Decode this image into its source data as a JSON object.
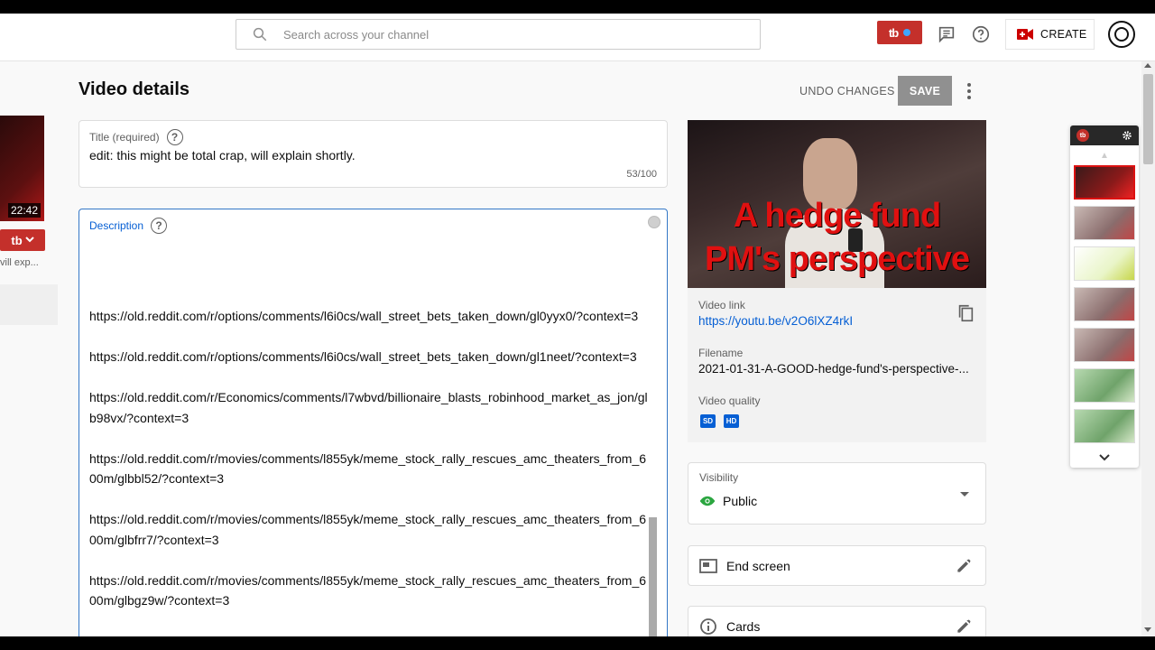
{
  "header": {
    "search_placeholder": "Search across your channel",
    "tb_label": "tb",
    "create_label": "CREATE"
  },
  "left_strip": {
    "duration": "22:42",
    "tb_label": "tb",
    "snippet": "vill exp..."
  },
  "page": {
    "title": "Video details",
    "undo_label": "UNDO CHANGES",
    "save_label": "SAVE"
  },
  "title_field": {
    "label": "Title (required)",
    "value": "edit: this might be total crap, will explain shortly.",
    "count": "53/100"
  },
  "description": {
    "label": "Description",
    "links": [
      "https://old.reddit.com/r/options/comments/l6i0cs/wall_street_bets_taken_down/gl0yyx0/?context=3",
      "https://old.reddit.com/r/options/comments/l6i0cs/wall_street_bets_taken_down/gl1neet/?context=3",
      "https://old.reddit.com/r/Economics/comments/l7wbvd/billionaire_blasts_robinhood_market_as_jon/glb98vx/?context=3",
      "https://old.reddit.com/r/movies/comments/l855yk/meme_stock_rally_rescues_amc_theaters_from_600m/glbbl52/?context=3",
      "https://old.reddit.com/r/movies/comments/l855yk/meme_stock_rally_rescues_amc_theaters_from_600m/glbfrr7/?context=3",
      "https://old.reddit.com/r/movies/comments/l855yk/meme_stock_rally_rescues_amc_theaters_from_600m/glbgz9w/?context=3"
    ]
  },
  "preview": {
    "thumb_line1": "A hedge fund",
    "thumb_line2": "PM's perspective",
    "video_link_label": "Video link",
    "video_link": "https://youtu.be/v2O6lXZ4rkI",
    "filename_label": "Filename",
    "filename": "2021-01-31-A-GOOD-hedge-fund's-perspective-...",
    "quality_label": "Video quality",
    "quality_sd": "SD",
    "quality_hd": "HD"
  },
  "visibility": {
    "label": "Visibility",
    "value": "Public"
  },
  "end_screen": {
    "label": "End screen"
  },
  "cards": {
    "label": "Cards"
  },
  "tb_panel": {
    "logo": "tb"
  },
  "colors": {
    "accent_blue": "#065fd4",
    "brand_red": "#c4302b",
    "public_green": "#2ba640"
  }
}
